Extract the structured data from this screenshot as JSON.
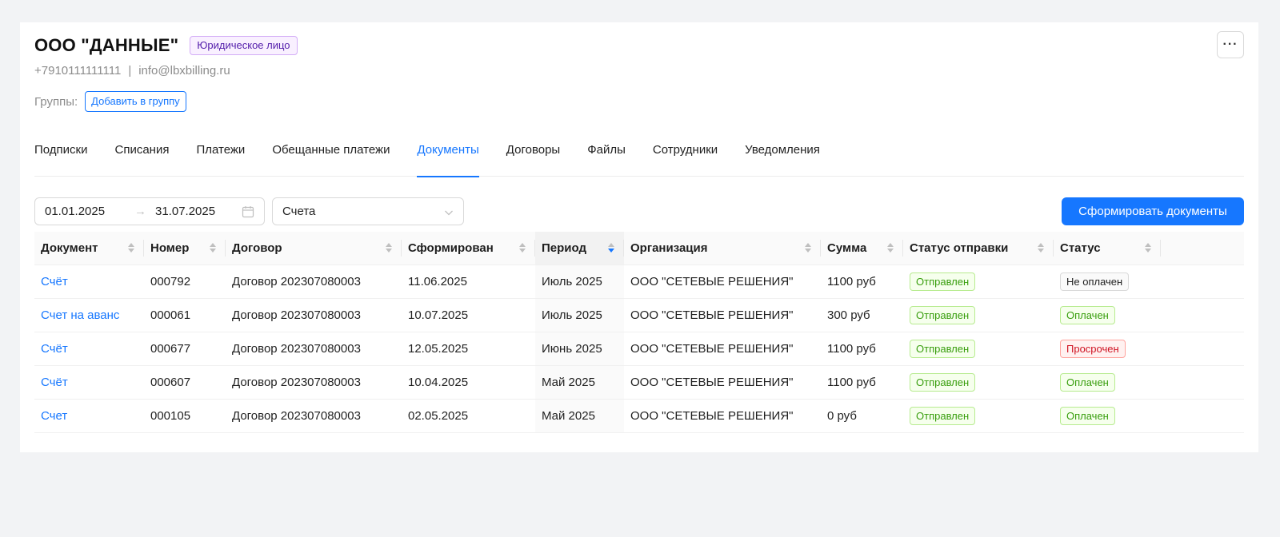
{
  "header": {
    "company_name": "ООО \"ДАННЫЕ\"",
    "type_badge": "Юридическое лицо",
    "more_label": "···",
    "phone": "+7910111111111",
    "separator": "|",
    "email": "info@lbxbilling.ru",
    "groups_label": "Группы:",
    "add_group_label": "Добавить в группу"
  },
  "tabs": [
    {
      "label": "Подписки",
      "active": false
    },
    {
      "label": "Списания",
      "active": false
    },
    {
      "label": "Платежи",
      "active": false
    },
    {
      "label": "Обещанные платежи",
      "active": false
    },
    {
      "label": "Документы",
      "active": true
    },
    {
      "label": "Договоры",
      "active": false
    },
    {
      "label": "Файлы",
      "active": false
    },
    {
      "label": "Сотрудники",
      "active": false
    },
    {
      "label": "Уведомления",
      "active": false
    }
  ],
  "filters": {
    "date_from": "01.01.2025",
    "date_arrow": "→",
    "date_to": "31.07.2025",
    "doc_type": "Счета",
    "generate_label": "Сформировать документы"
  },
  "table": {
    "columns": [
      {
        "label": "Документ",
        "sort": "none"
      },
      {
        "label": "Номер",
        "sort": "none"
      },
      {
        "label": "Договор",
        "sort": "none"
      },
      {
        "label": "Сформирован",
        "sort": "none"
      },
      {
        "label": "Период",
        "sort": "desc"
      },
      {
        "label": "Организация",
        "sort": "none"
      },
      {
        "label": "Сумма",
        "sort": "none"
      },
      {
        "label": "Статус отправки",
        "sort": "none"
      },
      {
        "label": "Статус",
        "sort": "none"
      }
    ],
    "rows": [
      {
        "document": "Счёт",
        "number": "000792",
        "contract": "Договор 202307080003",
        "created": "11.06.2025",
        "period": "Июль 2025",
        "organization": "ООО \"СЕТЕВЫЕ РЕШЕНИЯ\"",
        "amount": "1100 руб",
        "send_status": "Отправлен",
        "status": "Не оплачен",
        "status_color": "gray"
      },
      {
        "document": "Счет на аванс",
        "number": "000061",
        "contract": "Договор 202307080003",
        "created": "10.07.2025",
        "period": "Июль 2025",
        "organization": "ООО \"СЕТЕВЫЕ РЕШЕНИЯ\"",
        "amount": "300 руб",
        "send_status": "Отправлен",
        "status": "Оплачен",
        "status_color": "green"
      },
      {
        "document": "Счёт",
        "number": "000677",
        "contract": "Договор 202307080003",
        "created": "12.05.2025",
        "period": "Июнь 2025",
        "organization": "ООО \"СЕТЕВЫЕ РЕШЕНИЯ\"",
        "amount": "1100 руб",
        "send_status": "Отправлен",
        "status": "Просрочен",
        "status_color": "red"
      },
      {
        "document": "Счёт",
        "number": "000607",
        "contract": "Договор 202307080003",
        "created": "10.04.2025",
        "period": "Май 2025",
        "organization": "ООО \"СЕТЕВЫЕ РЕШЕНИЯ\"",
        "amount": "1100 руб",
        "send_status": "Отправлен",
        "status": "Оплачен",
        "status_color": "green"
      },
      {
        "document": "Счет",
        "number": "000105",
        "contract": "Договор 202307080003",
        "created": "02.05.2025",
        "period": "Май 2025",
        "organization": "ООО \"СЕТЕВЫЕ РЕШЕНИЯ\"",
        "amount": "0 руб",
        "send_status": "Отправлен",
        "status": "Оплачен",
        "status_color": "green"
      }
    ]
  },
  "colors": {
    "accent": "#1677ff",
    "badge_purple": "#531dab",
    "success": "#389e0d",
    "danger": "#cf1322"
  }
}
